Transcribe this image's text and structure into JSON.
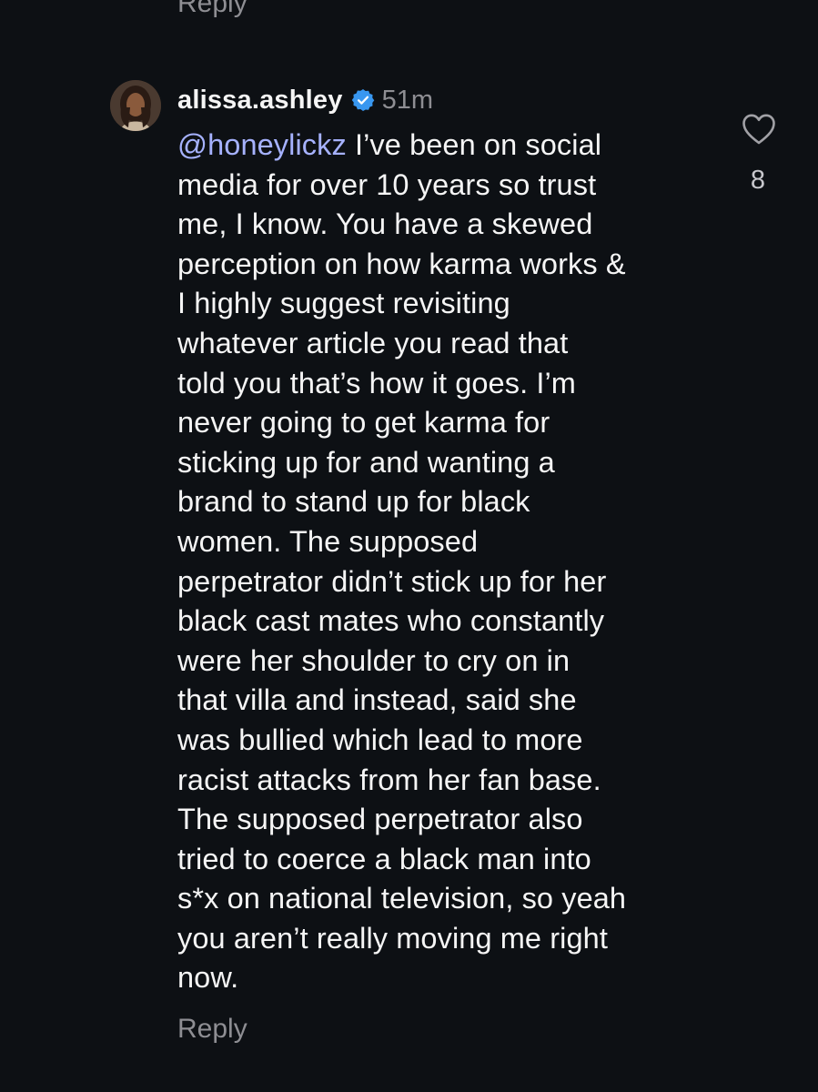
{
  "top_reply_label": "Reply",
  "comment": {
    "username": "alissa.ashley",
    "verified": true,
    "verified_icon": "verified-badge-icon",
    "time": "51m",
    "mention": "@honeylickz",
    "lines": [
      " I’ve been on social",
      "media for over 10 years so trust",
      "me, I know. You have a skewed",
      "perception on how karma works &",
      "I highly suggest revisiting",
      "whatever article you read that",
      "told you that’s how it goes. I’m",
      "never going to get karma for",
      "sticking up for and wanting a",
      "brand to stand up for black",
      "women. The supposed",
      "perpetrator didn’t stick up for her",
      "black cast mates who constantly",
      "were her shoulder to cry on in",
      "that villa and instead, said she",
      "was bullied which lead to more",
      "racist attacks from her fan base.",
      "The supposed perpetrator also",
      "tried to coerce a black man into",
      "s*x on national television, so yeah",
      "you aren’t really moving me right",
      "now."
    ],
    "like_icon": "heart-outline-icon",
    "like_count": "8",
    "reply_label": "Reply"
  },
  "colors": {
    "background": "#0d1014",
    "text": "#f5f5f5",
    "secondary": "#8e8e93",
    "mention": "#a6b2ff",
    "verified": "#3897f0"
  }
}
